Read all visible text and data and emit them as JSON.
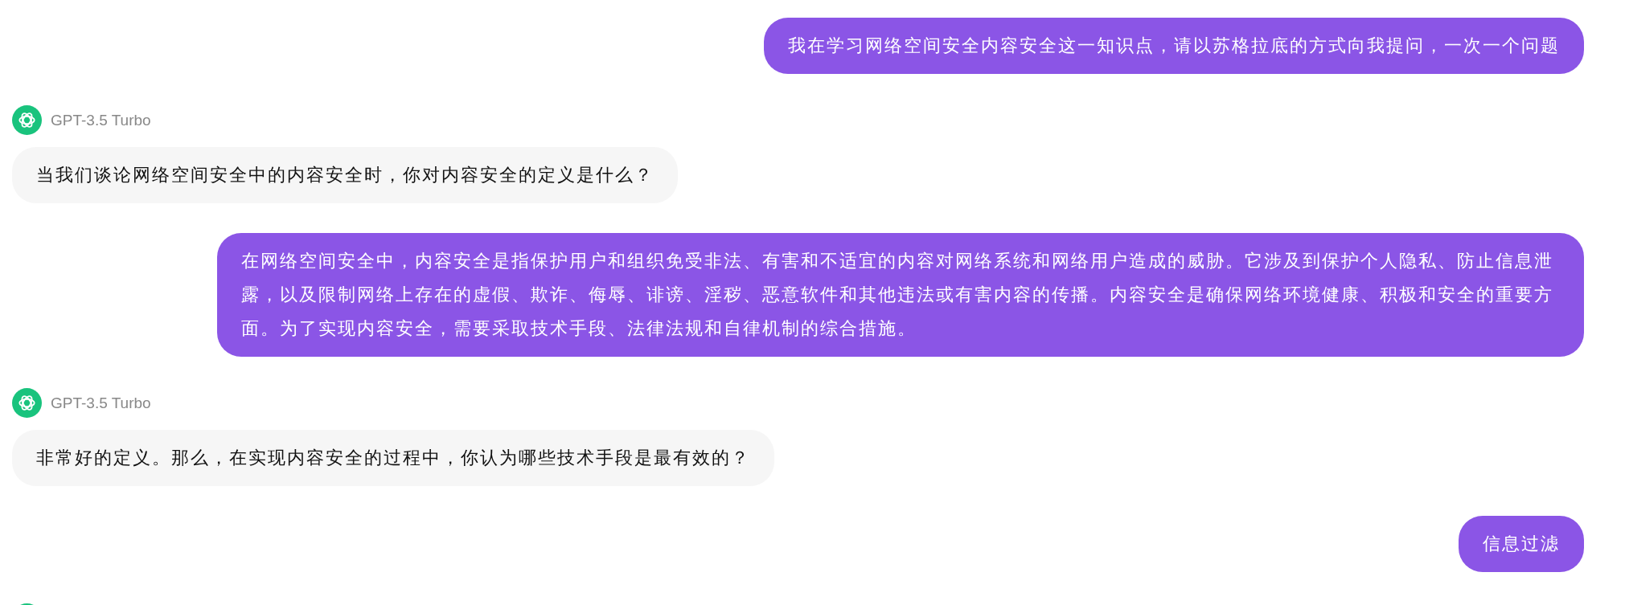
{
  "messages": [
    {
      "kind": "user",
      "text": "我在学习网络空间安全内容安全这一知识点，请以苏格拉底的方式向我提问，一次一个问题"
    },
    {
      "kind": "assistant",
      "model": "GPT-3.5 Turbo",
      "text": "当我们谈论网络空间安全中的内容安全时，你对内容安全的定义是什么？"
    },
    {
      "kind": "user",
      "text": "在网络空间安全中，内容安全是指保护用户和组织免受非法、有害和不适宜的内容对网络系统和网络用户造成的威胁。它涉及到保护个人隐私、防止信息泄露，以及限制网络上存在的虚假、欺诈、侮辱、诽谤、淫秽、恶意软件和其他违法或有害内容的传播。内容安全是确保网络环境健康、积极和安全的重要方面。为了实现内容安全，需要采取技术手段、法律法规和自律机制的综合措施。"
    },
    {
      "kind": "assistant",
      "model": "GPT-3.5 Turbo",
      "text": "非常好的定义。那么，在实现内容安全的过程中，你认为哪些技术手段是最有效的？"
    },
    {
      "kind": "user",
      "text": "信息过滤"
    }
  ],
  "trailing_avatar": true
}
